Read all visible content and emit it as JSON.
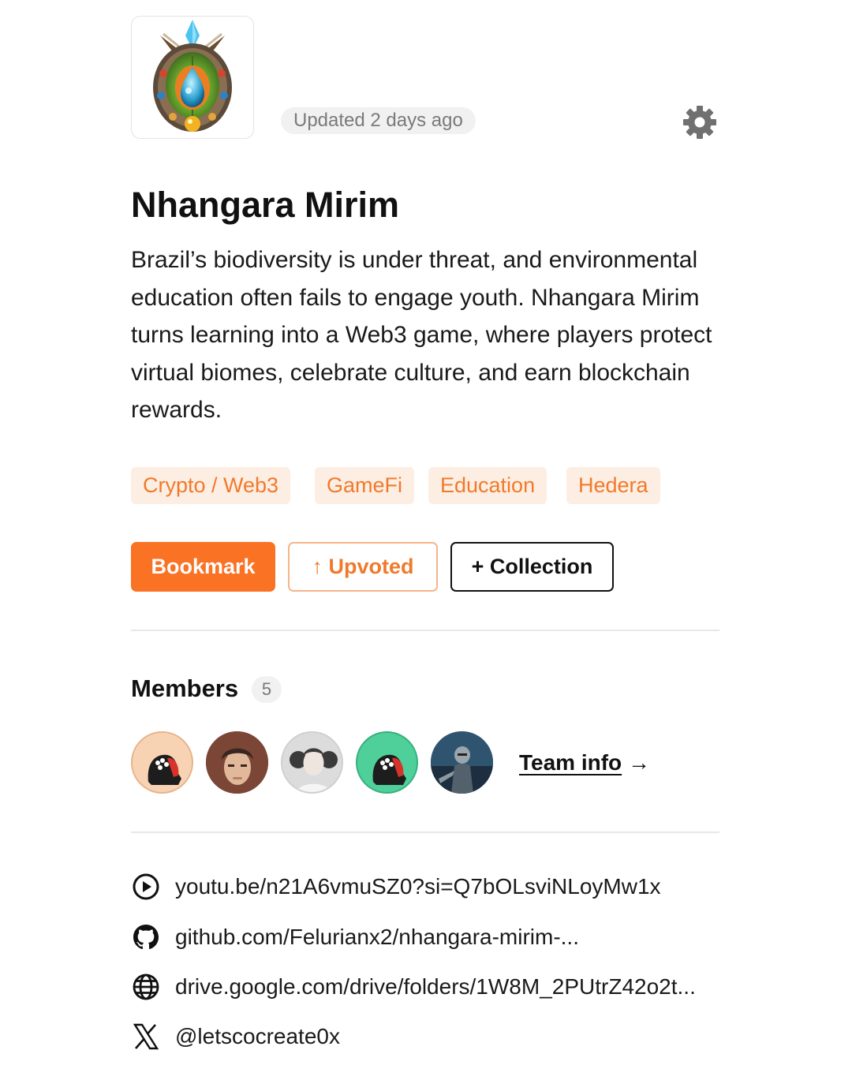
{
  "header": {
    "updated_label": "Updated 2 days ago",
    "settings_icon": "gear-icon"
  },
  "project": {
    "title": "Nhangara Mirim",
    "description": "Brazil’s biodiversity is under threat, and environmental education often fails to engage youth. Nhangara Mirim turns learning into a Web3 game, where players protect virtual biomes, celebrate culture, and earn blockchain rewards."
  },
  "tags": [
    "Crypto / Web3",
    "GameFi",
    "Education",
    "Hedera"
  ],
  "actions": {
    "bookmark": "Bookmark",
    "upvoted": "↑ Upvoted",
    "collection": "+ Collection"
  },
  "members": {
    "title": "Members",
    "count": "5",
    "team_info": "Team info",
    "team_info_arrow": "→"
  },
  "links": [
    {
      "icon": "play-circle-icon",
      "text": "youtu.be/n21A6vmuSZ0?si=Q7bOLsviNLoyMw1x"
    },
    {
      "icon": "github-icon",
      "text": "github.com/Felurianx2/nhangara-mirim-..."
    },
    {
      "icon": "globe-icon",
      "text": "drive.google.com/drive/folders/1W8M_2PUtrZ42o2t..."
    },
    {
      "icon": "x-icon",
      "text": "@letscocreate0x"
    }
  ],
  "colors": {
    "accent": "#fa7224",
    "tag_bg": "#fdeee3",
    "tag_text": "#f07a2c"
  }
}
